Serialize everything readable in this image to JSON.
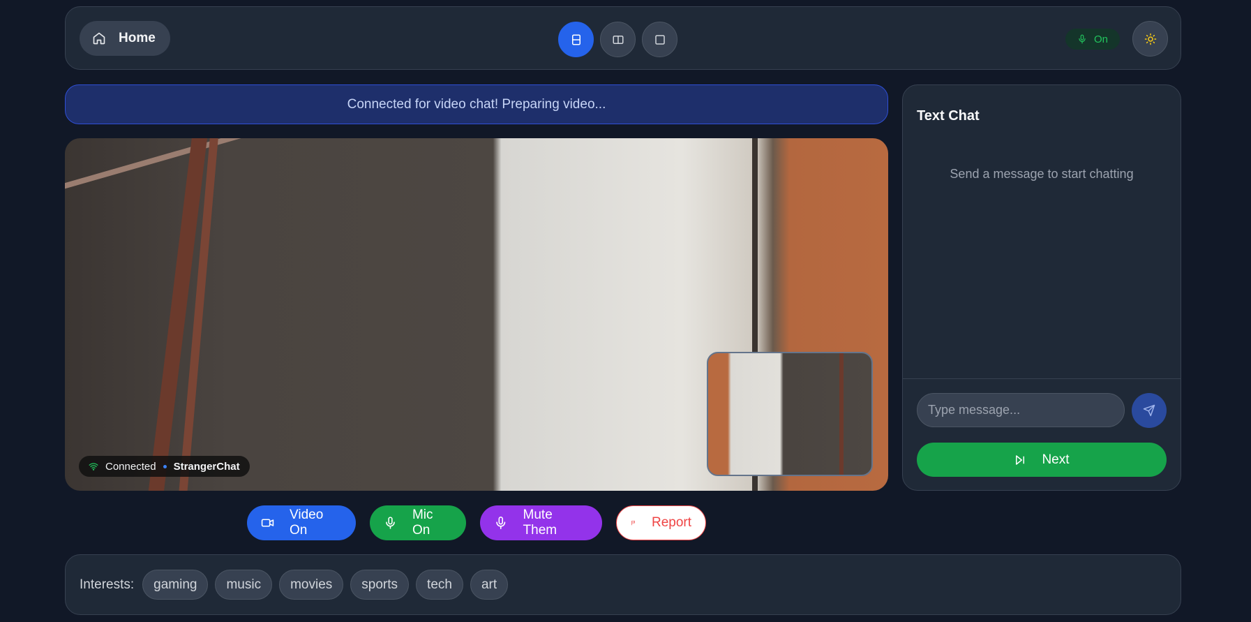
{
  "header": {
    "home_label": "Home",
    "layout_buttons": [
      "stacked-layout",
      "side-by-side-layout",
      "single-layout"
    ],
    "mic_status": "On"
  },
  "banner": {
    "text": "Connected for video chat! Preparing video..."
  },
  "video": {
    "status": "Connected",
    "brand": "StrangerChat"
  },
  "controls": {
    "video_label": "Video On",
    "mic_label": "Mic On",
    "mute_label": "Mute Them",
    "report_label": "Report"
  },
  "chat": {
    "title": "Text Chat",
    "empty_message": "Send a message to start chatting",
    "input_placeholder": "Type message...",
    "next_label": "Next"
  },
  "interests": {
    "label": "Interests:",
    "tags": [
      "gaming",
      "music",
      "movies",
      "sports",
      "tech",
      "art"
    ]
  },
  "colors": {
    "background": "#111827",
    "panel": "#1f2937",
    "accent_blue": "#2563eb",
    "accent_green": "#16a34a",
    "accent_purple": "#9333ea",
    "danger": "#ef4444"
  }
}
